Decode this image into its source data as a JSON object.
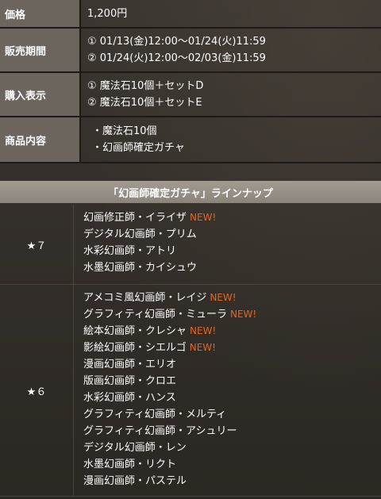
{
  "info": {
    "price": {
      "label": "価格",
      "value": "1,200円"
    },
    "period": {
      "label": "販売期間",
      "lines": [
        "① 01/13(金)12:00～01/24(火)11:59",
        "② 01/24(火)12:00～02/03(金)11:59"
      ]
    },
    "display": {
      "label": "購入表示",
      "lines": [
        "① 魔法石10個＋セットD",
        "② 魔法石10個＋セットE"
      ]
    },
    "contents": {
      "label": "商品内容",
      "lines": [
        "・魔法石10個",
        "・幻画師確定ガチャ"
      ]
    }
  },
  "lineup": {
    "title": "「幻画師確定ガチャ」ラインナップ",
    "new_label": "NEW!",
    "tiers": [
      {
        "rank": "★７",
        "characters": [
          {
            "name": "幻画修正師・イライザ",
            "new": true
          },
          {
            "name": "デジタル幻画師・プリム",
            "new": false
          },
          {
            "name": "水彩幻画師・アトリ",
            "new": false
          },
          {
            "name": "水墨幻画師・カイシュウ",
            "new": false
          }
        ]
      },
      {
        "rank": "★６",
        "characters": [
          {
            "name": "アメコミ風幻画師・レイジ",
            "new": true
          },
          {
            "name": "グラフィティ幻画師・ミューラ",
            "new": true
          },
          {
            "name": "絵本幻画師・クレシャ",
            "new": true
          },
          {
            "name": "影絵幻画師・シエルゴ",
            "new": true
          },
          {
            "name": "漫画幻画師・エリオ",
            "new": false
          },
          {
            "name": "版画幻画師・クロエ",
            "new": false
          },
          {
            "name": "水彩幻画師・ハンス",
            "new": false
          },
          {
            "name": "グラフィティ幻画師・メルティ",
            "new": false
          },
          {
            "name": "グラフィティ幻画師・アシュリー",
            "new": false
          },
          {
            "name": "デジタル幻画師・レン",
            "new": false
          },
          {
            "name": "水墨幻画師・リクト",
            "new": false
          },
          {
            "name": "漫画幻画師・パステル",
            "new": false
          }
        ]
      }
    ]
  },
  "colors": {
    "header_cell": "#6b655d",
    "new_badge": "#e8641e",
    "title_bar": "#9a9388"
  }
}
